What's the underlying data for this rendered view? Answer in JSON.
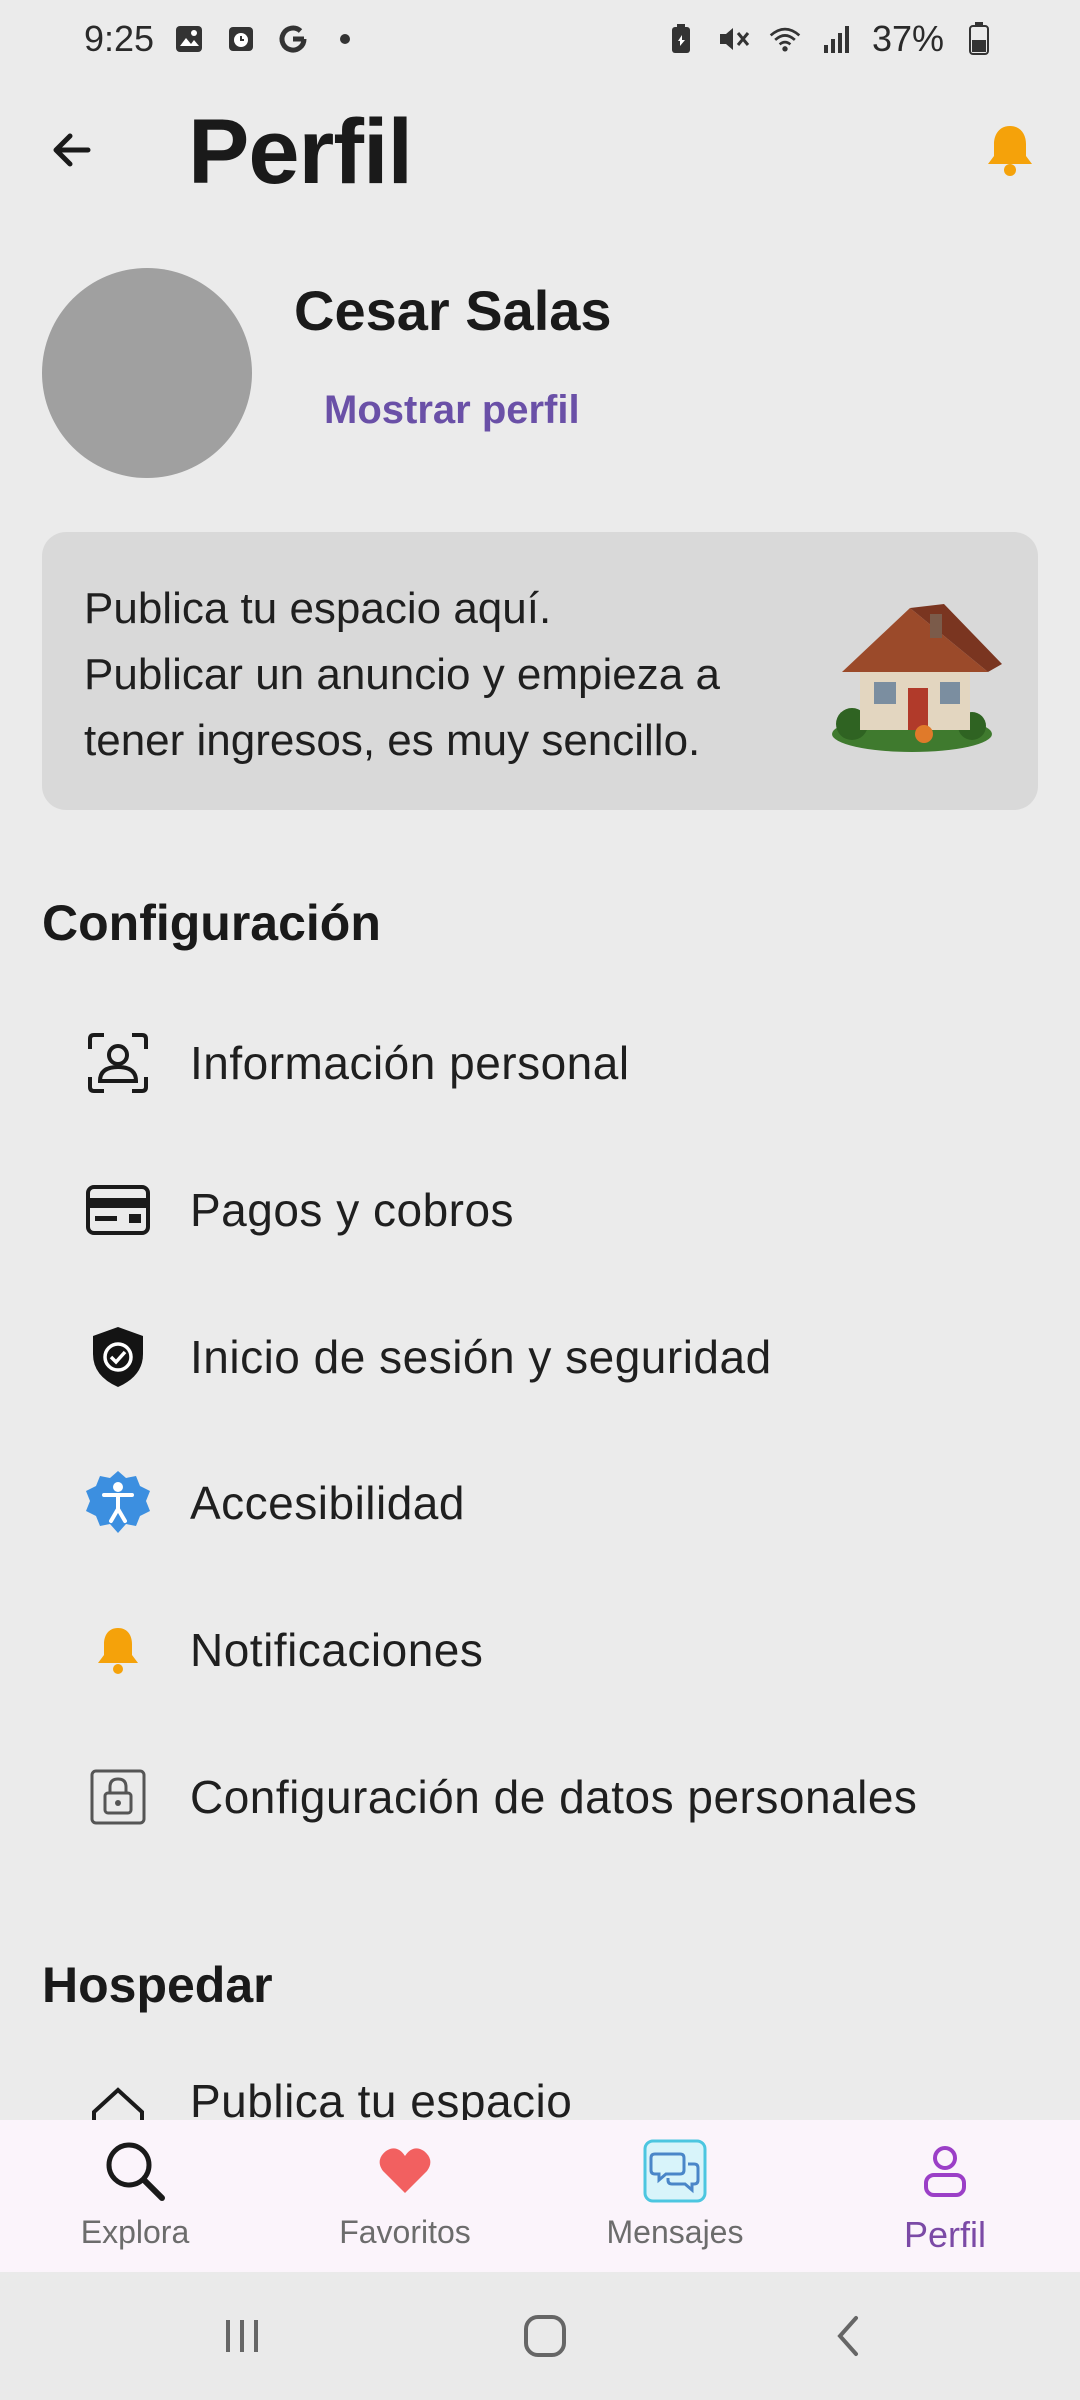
{
  "status_bar": {
    "time": "9:25",
    "battery": "37%",
    "left_icons": [
      "gallery-icon",
      "calendar-icon",
      "google-icon",
      "dot-icon"
    ],
    "right_icons": [
      "battery-saver-icon",
      "mute-icon",
      "wifi-icon",
      "signal-icon",
      "battery-icon"
    ]
  },
  "header": {
    "title": "Perfil",
    "back_icon": "back-arrow-icon",
    "bell_icon": "bell-icon",
    "bell_color": "#f5a20a"
  },
  "profile": {
    "name": "Cesar Salas",
    "show_profile": "Mostrar perfil",
    "link_color": "#6a50a7"
  },
  "banner": {
    "lines": [
      "Publica tu espacio aquí.",
      "Publicar un anuncio y empieza a",
      "tener ingresos, es muy sencillo."
    ],
    "image": "house-illustration"
  },
  "config": {
    "title": "Configuración",
    "items": [
      {
        "label": "Información personal",
        "icon": "user-profile-icon"
      },
      {
        "label": "Pagos y cobros",
        "icon": "credit-card-icon"
      },
      {
        "label": "Inicio de sesión y seguridad",
        "icon": "shield-check-icon"
      },
      {
        "label": "Accesibilidad",
        "icon": "accessibility-icon"
      },
      {
        "label": "Notificaciones",
        "icon": "bell-icon"
      },
      {
        "label": "Configuración de datos personales",
        "icon": "lock-icon"
      }
    ]
  },
  "host": {
    "title": "Hospedar",
    "items": [
      {
        "label": "Publica tu espacio",
        "icon": "house-icon"
      }
    ]
  },
  "bottom_nav": {
    "items": [
      {
        "label": "Explora",
        "icon": "search-icon"
      },
      {
        "label": "Favoritos",
        "icon": "heart-icon"
      },
      {
        "label": "Mensajes",
        "icon": "chat-icon"
      },
      {
        "label": "Perfil",
        "icon": "person-icon",
        "active": true
      }
    ],
    "active_color": "#7b4aa6"
  },
  "system_nav": [
    "recents-icon",
    "home-icon",
    "back-icon"
  ]
}
